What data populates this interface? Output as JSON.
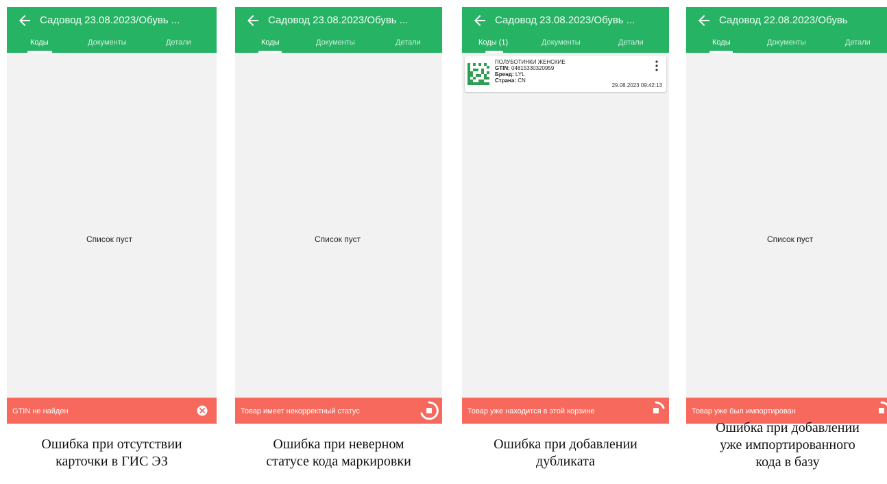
{
  "colors": {
    "appbar": "#27b364",
    "snackbar": "#f7695d",
    "background": "#f2f2f2"
  },
  "icons": {
    "back": "arrow-left-icon",
    "close": "close-circle-icon",
    "progress": "progress-stop-icon",
    "more": "more-vertical-icon"
  },
  "tabs": {
    "codes": "Коды",
    "documents": "Документы",
    "details": "Детали"
  },
  "empty_text": "Список пуст",
  "screens": [
    {
      "title": "Садовод 23.08.2023/Обувь ...",
      "codes_count": "",
      "snackbar": "GTIN не найден",
      "caption": [
        "Ошибка при отсутствии",
        "карточки в ГИС ЭЗ"
      ]
    },
    {
      "title": "Садовод 23.08.2023/Обувь ...",
      "codes_count": "",
      "snackbar": "Товар имеет некорректный статус",
      "caption": [
        "Ошибка при неверном",
        "статусе кода маркировки"
      ]
    },
    {
      "title": "Садовод 23.08.2023/Обувь ...",
      "codes_count": "(1)",
      "snackbar": "Товар уже находится в этой корзине",
      "caption": [
        "Ошибка при добавлении",
        "дубликата"
      ],
      "card": {
        "name": "ПОЛУБОТИНКИ ЖЕНСКИЕ",
        "gtin_label": "GTIN:",
        "gtin": "04815330320959",
        "brand_label": "Бренд:",
        "brand": "LYL",
        "country_label": "Страна:",
        "country": "CN",
        "timestamp": "29.08.2023 09:42:13"
      }
    },
    {
      "title": "Садовод 22.08.2023/Обувь",
      "codes_count": "",
      "snackbar": "Товар уже был импортирован",
      "caption": [
        "Ошибка при добавлении",
        "уже импортированного",
        "кода в базу"
      ]
    }
  ]
}
